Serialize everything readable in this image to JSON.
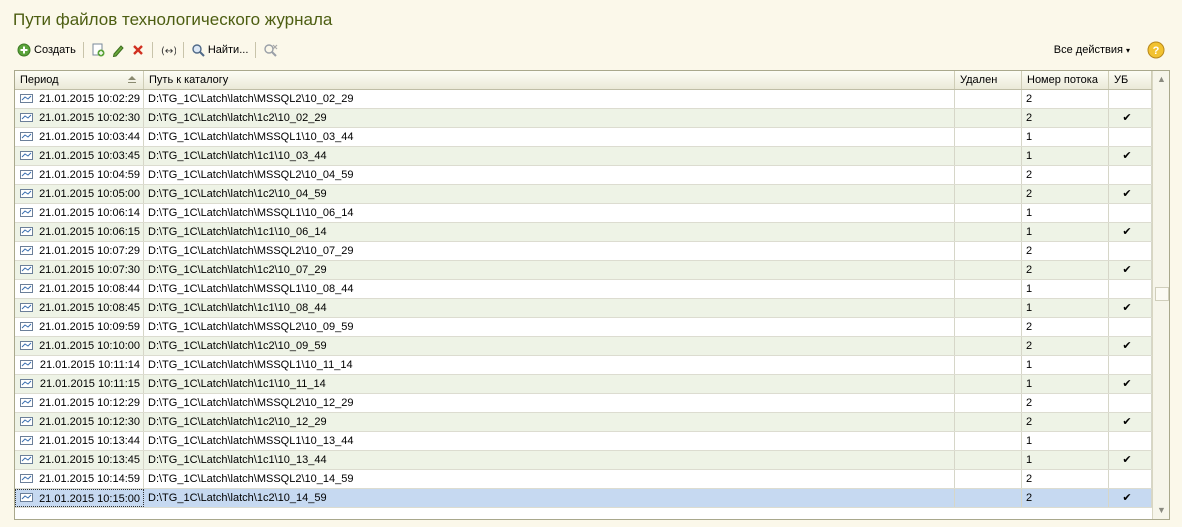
{
  "window": {
    "title": "Пути файлов технологического журнала"
  },
  "toolbar": {
    "create_label": "Создать",
    "find_label": "Найти...",
    "all_actions_label": "Все действия",
    "buttons": [
      "add-copy-icon",
      "edit-pencil-icon",
      "delete-x-icon",
      "interval-icon",
      "search-icon",
      "clear-search-icon",
      "help-icon"
    ]
  },
  "table": {
    "columns": [
      "Период",
      "Путь к каталогу",
      "Удален",
      "Номер потока",
      "УБ"
    ],
    "rows": [
      {
        "period": "21.01.2015 10:02:29",
        "path": "D:\\TG_1C\\Latch\\latch\\MSSQL2\\10_02_29",
        "deleted": "",
        "stream": "2",
        "ub": ""
      },
      {
        "period": "21.01.2015 10:02:30",
        "path": "D:\\TG_1C\\Latch\\latch\\1c2\\10_02_29",
        "deleted": "",
        "stream": "2",
        "ub": "✔"
      },
      {
        "period": "21.01.2015 10:03:44",
        "path": "D:\\TG_1C\\Latch\\latch\\MSSQL1\\10_03_44",
        "deleted": "",
        "stream": "1",
        "ub": ""
      },
      {
        "period": "21.01.2015 10:03:45",
        "path": "D:\\TG_1C\\Latch\\latch\\1c1\\10_03_44",
        "deleted": "",
        "stream": "1",
        "ub": "✔"
      },
      {
        "period": "21.01.2015 10:04:59",
        "path": "D:\\TG_1C\\Latch\\latch\\MSSQL2\\10_04_59",
        "deleted": "",
        "stream": "2",
        "ub": ""
      },
      {
        "period": "21.01.2015 10:05:00",
        "path": "D:\\TG_1C\\Latch\\latch\\1c2\\10_04_59",
        "deleted": "",
        "stream": "2",
        "ub": "✔"
      },
      {
        "period": "21.01.2015 10:06:14",
        "path": "D:\\TG_1C\\Latch\\latch\\MSSQL1\\10_06_14",
        "deleted": "",
        "stream": "1",
        "ub": ""
      },
      {
        "period": "21.01.2015 10:06:15",
        "path": "D:\\TG_1C\\Latch\\latch\\1c1\\10_06_14",
        "deleted": "",
        "stream": "1",
        "ub": "✔"
      },
      {
        "period": "21.01.2015 10:07:29",
        "path": "D:\\TG_1C\\Latch\\latch\\MSSQL2\\10_07_29",
        "deleted": "",
        "stream": "2",
        "ub": ""
      },
      {
        "period": "21.01.2015 10:07:30",
        "path": "D:\\TG_1C\\Latch\\latch\\1c2\\10_07_29",
        "deleted": "",
        "stream": "2",
        "ub": "✔"
      },
      {
        "period": "21.01.2015 10:08:44",
        "path": "D:\\TG_1C\\Latch\\latch\\MSSQL1\\10_08_44",
        "deleted": "",
        "stream": "1",
        "ub": ""
      },
      {
        "period": "21.01.2015 10:08:45",
        "path": "D:\\TG_1C\\Latch\\latch\\1c1\\10_08_44",
        "deleted": "",
        "stream": "1",
        "ub": "✔"
      },
      {
        "period": "21.01.2015 10:09:59",
        "path": "D:\\TG_1C\\Latch\\latch\\MSSQL2\\10_09_59",
        "deleted": "",
        "stream": "2",
        "ub": ""
      },
      {
        "period": "21.01.2015 10:10:00",
        "path": "D:\\TG_1C\\Latch\\latch\\1c2\\10_09_59",
        "deleted": "",
        "stream": "2",
        "ub": "✔"
      },
      {
        "period": "21.01.2015 10:11:14",
        "path": "D:\\TG_1C\\Latch\\latch\\MSSQL1\\10_11_14",
        "deleted": "",
        "stream": "1",
        "ub": ""
      },
      {
        "period": "21.01.2015 10:11:15",
        "path": "D:\\TG_1C\\Latch\\latch\\1c1\\10_11_14",
        "deleted": "",
        "stream": "1",
        "ub": "✔"
      },
      {
        "period": "21.01.2015 10:12:29",
        "path": "D:\\TG_1C\\Latch\\latch\\MSSQL2\\10_12_29",
        "deleted": "",
        "stream": "2",
        "ub": ""
      },
      {
        "period": "21.01.2015 10:12:30",
        "path": "D:\\TG_1C\\Latch\\latch\\1c2\\10_12_29",
        "deleted": "",
        "stream": "2",
        "ub": "✔"
      },
      {
        "period": "21.01.2015 10:13:44",
        "path": "D:\\TG_1C\\Latch\\latch\\MSSQL1\\10_13_44",
        "deleted": "",
        "stream": "1",
        "ub": ""
      },
      {
        "period": "21.01.2015 10:13:45",
        "path": "D:\\TG_1C\\Latch\\latch\\1c1\\10_13_44",
        "deleted": "",
        "stream": "1",
        "ub": "✔"
      },
      {
        "period": "21.01.2015 10:14:59",
        "path": "D:\\TG_1C\\Latch\\latch\\MSSQL2\\10_14_59",
        "deleted": "",
        "stream": "2",
        "ub": ""
      },
      {
        "period": "21.01.2015 10:15:00",
        "path": "D:\\TG_1C\\Latch\\latch\\1c2\\10_14_59",
        "deleted": "",
        "stream": "2",
        "ub": "✔"
      }
    ],
    "selected_row_index": 21
  },
  "colors": {
    "title": "#4d5e12",
    "background": "#fbf8ea",
    "row_alt": "#eef3e6",
    "row_selected": "#c6d9f1"
  }
}
